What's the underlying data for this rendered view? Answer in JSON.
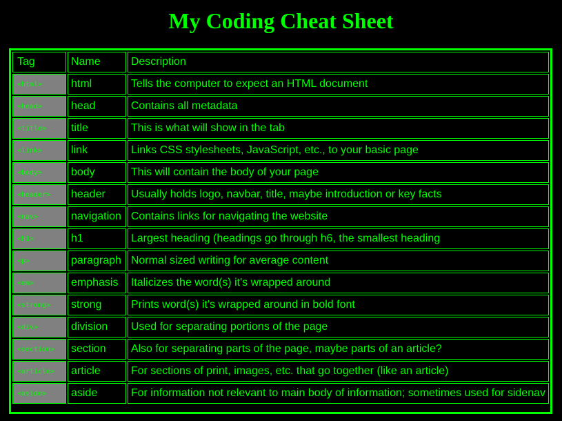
{
  "title": "My Coding Cheat Sheet",
  "colors": {
    "text": "#00ff00",
    "background": "#000000",
    "tag_cell": "#808080"
  },
  "table": {
    "headers": [
      "Tag",
      "Name",
      "Description"
    ],
    "rows": [
      {
        "tag": "<html>",
        "name": "html",
        "description": "Tells the computer to expect an HTML document"
      },
      {
        "tag": "<head>",
        "name": "head",
        "description": "Contains all metadata"
      },
      {
        "tag": "<title>",
        "name": "title",
        "description": "This is what will show in the tab"
      },
      {
        "tag": "<link>",
        "name": "link",
        "description": "Links CSS stylesheets, JavaScript, etc., to your basic page"
      },
      {
        "tag": "<body>",
        "name": "body",
        "description": "This will contain the body of your page"
      },
      {
        "tag": "<header>",
        "name": "header",
        "description": "Usually holds logo, navbar, title, maybe introduction or key facts"
      },
      {
        "tag": "<nav>",
        "name": "navigation",
        "description": "Contains links for navigating the website"
      },
      {
        "tag": "<h1>",
        "name": "h1",
        "description": "Largest heading (headings go through h6, the smallest heading"
      },
      {
        "tag": "<p>",
        "name": "paragraph",
        "description": "Normal sized writing for average content"
      },
      {
        "tag": "<em>",
        "name": "emphasis",
        "description": "Italicizes the word(s) it's wrapped around"
      },
      {
        "tag": "<strong>",
        "name": "strong",
        "description": "Prints word(s) it's wrapped around in bold font"
      },
      {
        "tag": "<div>",
        "name": "division",
        "description": "Used for separating portions of the page"
      },
      {
        "tag": "<section>",
        "name": "section",
        "description": "Also for separating parts of the page, maybe parts of an article?"
      },
      {
        "tag": "<article>",
        "name": "article",
        "description": "For sections of print, images, etc. that go together (like an article)"
      },
      {
        "tag": "<aside>",
        "name": "aside",
        "description": "For information not relevant to main body of information; sometimes used for sidenav"
      }
    ]
  }
}
